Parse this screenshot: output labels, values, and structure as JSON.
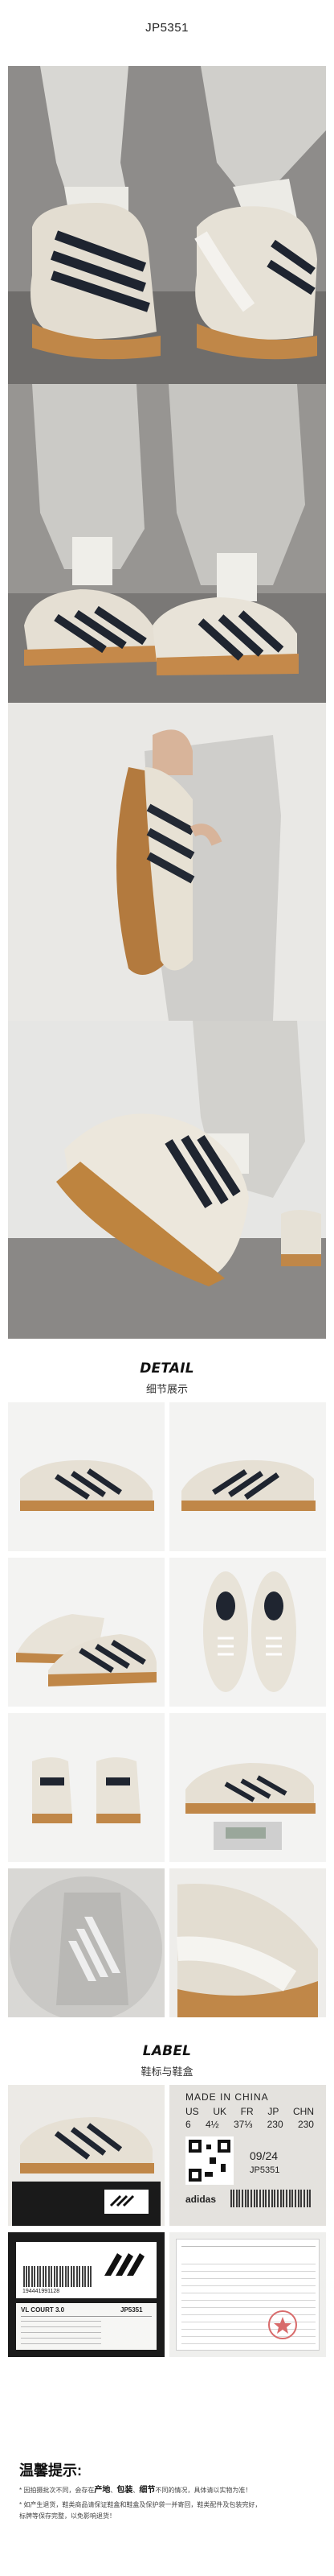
{
  "product_code": "JP5351",
  "detail": {
    "title": "DETAIL",
    "subtitle": "细节展示"
  },
  "label": {
    "title": "LABEL",
    "subtitle": "鞋标与鞋盒"
  },
  "tag": {
    "made_in": "MADE IN CHINA",
    "size_header": [
      "US",
      "UK",
      "FR",
      "JP",
      "CHN"
    ],
    "size_values": [
      "6",
      "4½",
      "37⅓",
      "230",
      "230"
    ],
    "date": "09/24",
    "article": "JP5351",
    "brand": "adidas"
  },
  "box_label": {
    "model": "VL COURT 3.0",
    "code": "JP5351",
    "barcode_digits": "194441991128"
  },
  "tips": {
    "title": "温馨提示:",
    "line1_pre": "* 因拍摄批次不同，会存在",
    "line1_kw1": "产地",
    "line1_kw2": "包装",
    "line1_kw3": "细节",
    "line1_post": "不同的情况，具体请以实物为准！",
    "line2": "* 如产生退货，鞋类商品请保证鞋盒和鞋盒及保护袋一并寄回，鞋类配件及包装完好，",
    "line3": "标牌等保存完整，以免影响退货！"
  }
}
